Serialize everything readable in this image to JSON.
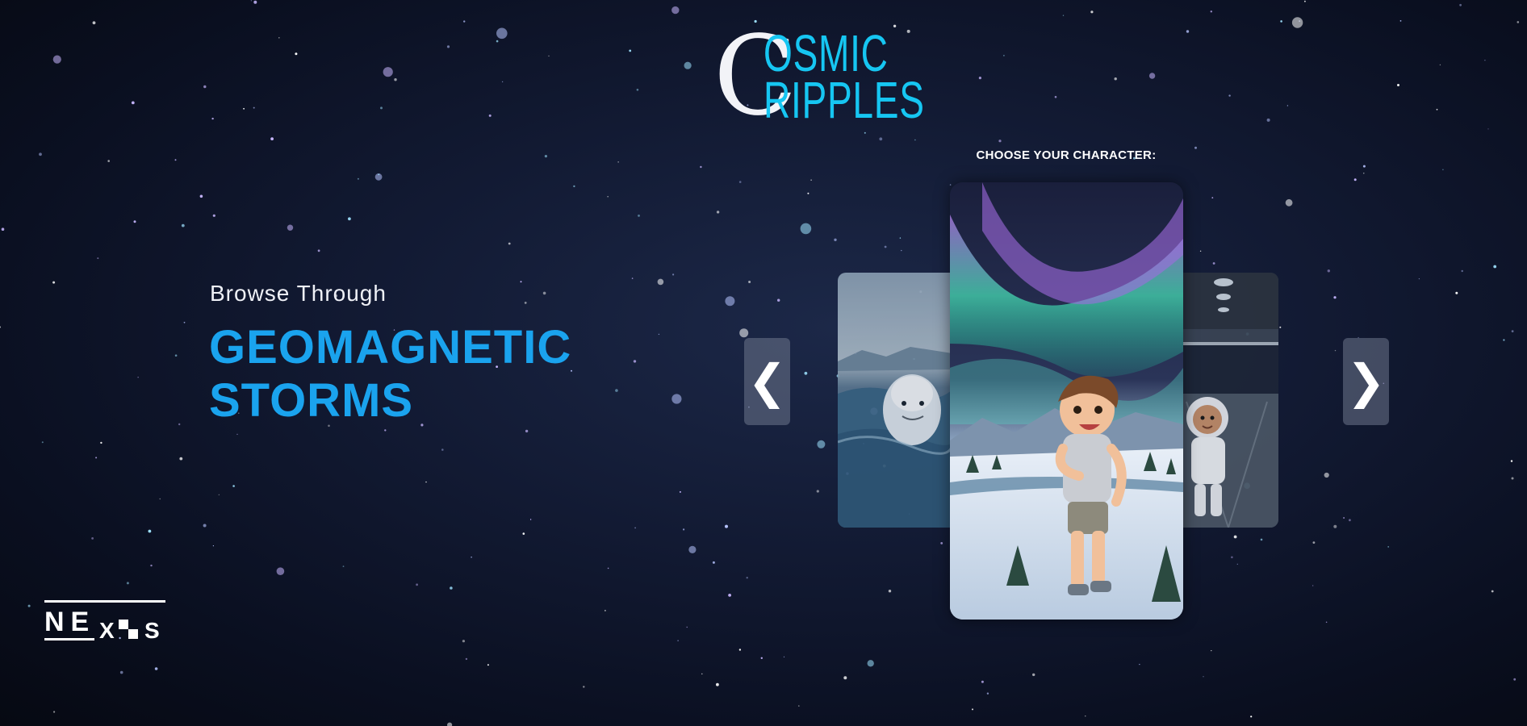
{
  "logo": {
    "initial": "C",
    "line1": "OSMIC",
    "line2": "RIPPLES"
  },
  "selector": {
    "heading": "CHOOSE YOUR CHARACTER:"
  },
  "hero": {
    "subtitle": "Browse Through",
    "title_line1": "GEOMAGNETIC",
    "title_line2": "STORMS"
  },
  "carousel": {
    "prev_icon": "chevron-left-icon",
    "next_icon": "chevron-right-icon",
    "prev_glyph": "❮",
    "next_glyph": "❯",
    "cards": [
      {
        "position": "left",
        "subject": "beluga-whale"
      },
      {
        "position": "center",
        "subject": "boy-under-aurora"
      },
      {
        "position": "right",
        "subject": "astronaut"
      }
    ]
  },
  "brand": {
    "name": "NEXUS",
    "visible_text": "NEXus"
  },
  "colors": {
    "accent": "#1aa3ee",
    "logo_cyan": "#16c6f2",
    "background": "#0a0f20"
  }
}
